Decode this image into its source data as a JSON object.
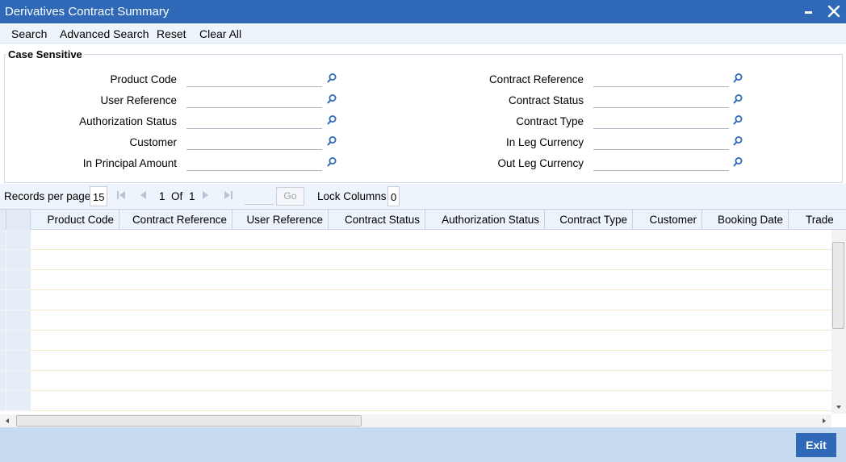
{
  "window": {
    "title": "Derivatives Contract Summary"
  },
  "toolbar": {
    "search": "Search",
    "advanced_search": "Advanced Search",
    "reset": "Reset",
    "clear_all": "Clear All"
  },
  "panel": {
    "legend": "Case Sensitive"
  },
  "fields": {
    "product_code": {
      "label": "Product Code",
      "value": ""
    },
    "user_reference": {
      "label": "User Reference",
      "value": ""
    },
    "authorization_status": {
      "label": "Authorization Status",
      "value": ""
    },
    "customer": {
      "label": "Customer",
      "value": ""
    },
    "in_principal_amount": {
      "label": "In Principal Amount",
      "value": ""
    },
    "contract_reference": {
      "label": "Contract Reference",
      "value": ""
    },
    "contract_status": {
      "label": "Contract Status",
      "value": ""
    },
    "contract_type": {
      "label": "Contract Type",
      "value": ""
    },
    "in_leg_currency": {
      "label": "In Leg Currency",
      "value": ""
    },
    "out_leg_currency": {
      "label": "Out Leg Currency",
      "value": ""
    }
  },
  "pager": {
    "records_label": "Records per page",
    "records_value": "15",
    "current_page": "1",
    "of_label": "Of",
    "total_pages": "1",
    "go_label": "Go",
    "lock_label": "Lock Columns",
    "lock_value": "0"
  },
  "grid": {
    "columns": [
      "Product Code",
      "Contract Reference",
      "User Reference",
      "Contract Status",
      "Authorization Status",
      "Contract Type",
      "Customer",
      "Booking Date",
      "Trade"
    ]
  },
  "footer": {
    "exit_label": "Exit"
  },
  "colors": {
    "title_bar": "#2f69b8",
    "toolbar_bg": "#eef4fc",
    "footer_bg": "#c6daf0",
    "exit_button": "#2f69b8"
  }
}
